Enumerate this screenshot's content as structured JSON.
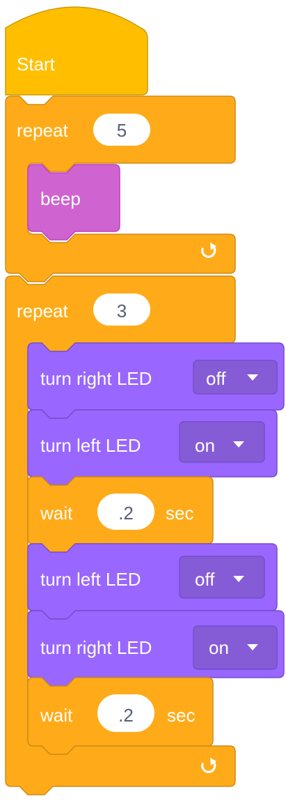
{
  "colors": {
    "event_fill": "#FFBF00",
    "event_stroke": "#CC9900",
    "control_fill": "#FFAB19",
    "control_stroke": "#CF8B17",
    "sound_fill": "#CF63CF",
    "sound_stroke": "#BD42BD",
    "looks_fill": "#9966FF",
    "looks_stroke": "#774DCB",
    "dropdown_fill": "#855CD6",
    "input_fill": "#FFFFFF",
    "input_text": "#575E75"
  },
  "script": {
    "hat_label": "Start",
    "loop1": {
      "label": "repeat",
      "count": "5",
      "body": {
        "label": "beep"
      }
    },
    "loop2": {
      "label": "repeat",
      "count": "3",
      "body": [
        {
          "kind": "led",
          "label": "turn right LED",
          "value": "off"
        },
        {
          "kind": "led",
          "label": "turn left LED",
          "value": "on"
        },
        {
          "kind": "wait",
          "label": "wait",
          "value": ".2",
          "unit": "sec"
        },
        {
          "kind": "led",
          "label": "turn left LED",
          "value": "off"
        },
        {
          "kind": "led",
          "label": "turn right LED",
          "value": "on"
        },
        {
          "kind": "wait",
          "label": "wait",
          "value": ".2",
          "unit": "sec"
        }
      ]
    },
    "loop_arrow_icon": "loop-arrow-icon",
    "dropdown_icon": "caret-down-icon"
  }
}
